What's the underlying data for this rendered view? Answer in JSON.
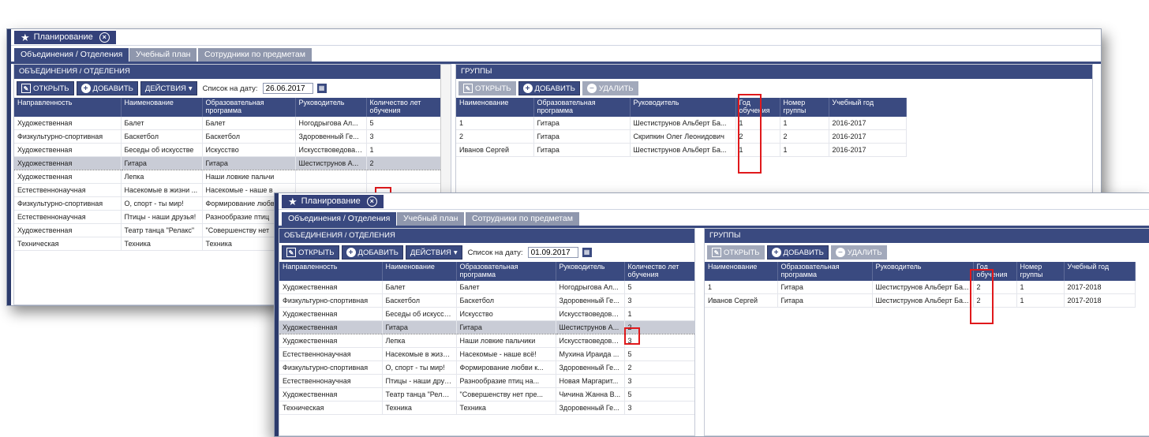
{
  "app": {
    "title": "Планирование"
  },
  "tabs": [
    "Объединения / Отделения",
    "Учебный план",
    "Сотрудники по предметам"
  ],
  "left_panel": {
    "title": "ОБЪЕДИНЕНИЯ / ОТДЕЛЕНИЯ",
    "open_label": "ОТКРЫТЬ",
    "add_label": "ДОБАВИТЬ",
    "actions_label": "ДЕЙСТВИЯ",
    "date_label": "Список на дату:",
    "columns": [
      "Направленность",
      "Наименование",
      "Образовательная программа",
      "Руководитель",
      "Количество лет обучения"
    ]
  },
  "right_panel": {
    "title": "ГРУППЫ",
    "open_label": "ОТКРЫТЬ",
    "add_label": "ДОБАВИТЬ",
    "delete_label": "УДАЛИТЬ",
    "columns": [
      "Наименование",
      "Образовательная программа",
      "Руководитель",
      "Год обучения",
      "Номер группы",
      "Учебный год"
    ]
  },
  "window1": {
    "date_value": "26.06.2017",
    "left_rows": [
      [
        "Художественная",
        "Балет",
        "Балет",
        "Ногодрыгова Ал...",
        "5"
      ],
      [
        "Физкультурно-спортивная",
        "Баскетбол",
        "Баскетбол",
        "Здоровенный Ге...",
        "3"
      ],
      [
        "Художественная",
        "Беседы об искусстве",
        "Искусство",
        "Искусствоведова ...",
        "1"
      ],
      [
        "Художественная",
        "Гитара",
        "Гитара",
        "Шестиструнов А...",
        "2"
      ],
      [
        "Художественная",
        "Лепка",
        "Наши ловкие пальчи",
        "",
        ""
      ],
      [
        "Естественнонаучная",
        "Насекомые в жизни ...",
        "Насекомые - наше в",
        "",
        ""
      ],
      [
        "Физкультурно-спортивная",
        "О, спорт - ты мир!",
        "Формирование любв",
        "",
        ""
      ],
      [
        "Естественнонаучная",
        "Птицы - наши друзья!",
        "Разнообразие птиц",
        "",
        ""
      ],
      [
        "Художественная",
        "Театр танца \"Релакс\"",
        "\"Совершенству нет",
        "",
        ""
      ],
      [
        "Техническая",
        "Техника",
        "Техника",
        "",
        ""
      ]
    ],
    "right_rows": [
      [
        "1",
        "Гитара",
        "Шестиструнов Альберт Ба...",
        "1",
        "1",
        "2016-2017"
      ],
      [
        "2",
        "Гитара",
        "Скрипкин Олег Леонидович",
        "2",
        "2",
        "2016-2017"
      ],
      [
        "Иванов Сергей",
        "Гитара",
        "Шестиструнов Альберт Ба...",
        "1",
        "1",
        "2016-2017"
      ]
    ]
  },
  "window2": {
    "date_value": "01.09.2017",
    "left_rows": [
      [
        "Художественная",
        "Балет",
        "Балет",
        "Ногодрыгова Ал...",
        "5"
      ],
      [
        "Физкультурно-спортивная",
        "Баскетбол",
        "Баскетбол",
        "Здоровенный Ге...",
        "3"
      ],
      [
        "Художественная",
        "Беседы об искусстве",
        "Искусство",
        "Искусствоведова ...",
        "1"
      ],
      [
        "Художественная",
        "Гитара",
        "Гитара",
        "Шестиструнов А...",
        "2"
      ],
      [
        "Художественная",
        "Лепка",
        "Наши ловкие пальчики",
        "Искусствоведова ...",
        "3"
      ],
      [
        "Естественнонаучная",
        "Насекомые в жизни ...",
        "Насекомые - наше всё!",
        "Мухина Ираида ...",
        "5"
      ],
      [
        "Физкультурно-спортивная",
        "О, спорт - ты мир!",
        "Формирование любви к...",
        "Здоровенный Ге...",
        "2"
      ],
      [
        "Естественнонаучная",
        "Птицы - наши друзья!",
        "Разнообразие птиц на...",
        "Новая Маргарит...",
        "3"
      ],
      [
        "Художественная",
        "Театр танца \"Релакс\"",
        "\"Совершенству нет пре...",
        "Чичина Жанна В...",
        "5"
      ],
      [
        "Техническая",
        "Техника",
        "Техника",
        "Здоровенный Ге...",
        "3"
      ]
    ],
    "right_rows": [
      [
        "1",
        "Гитара",
        "Шестиструнов Альберт Ба...",
        "2",
        "1",
        "2017-2018"
      ],
      [
        "Иванов Сергей",
        "Гитара",
        "Шестиструнов Альберт Ба...",
        "2",
        "1",
        "2017-2018"
      ]
    ]
  }
}
